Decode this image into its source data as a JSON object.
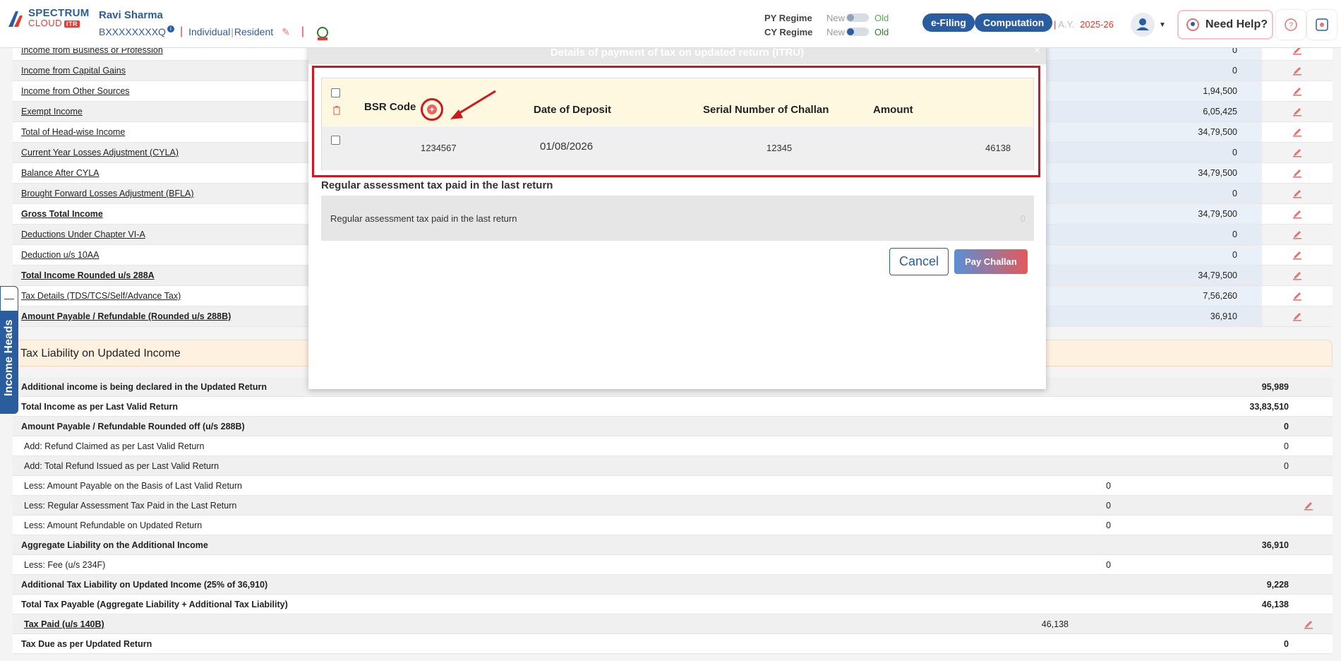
{
  "header": {
    "logo_line1": "SPECTRUM",
    "logo_line2": "CLOUD",
    "logo_badge": "ITR",
    "user_name": "Ravi Sharma",
    "pan": "BXXXXXXXXQ",
    "status_individual": "Individual",
    "status_resident": "Resident",
    "py_regime_label": "PY Regime",
    "cy_regime_label": "CY Regime",
    "toggle_new": "New",
    "toggle_old": "Old",
    "efiling": "e-Filing",
    "computation": "Computation",
    "ay_label": "A.Y.",
    "ay_value": "2025-26",
    "need_help": "Need Help?"
  },
  "income_heads": [
    {
      "label": "Income from Business or Profession",
      "value": "0"
    },
    {
      "label": "Income from Capital Gains",
      "value": "0"
    },
    {
      "label": "Income from Other Sources",
      "value": "1,94,500"
    },
    {
      "label": "Exempt Income",
      "value": "6,05,425"
    },
    {
      "label": "Total of Head-wise Income",
      "value": "34,79,500"
    },
    {
      "label": "Current Year Losses Adjustment (CYLA)",
      "value": "0"
    },
    {
      "label": "Balance After CYLA",
      "value": "34,79,500"
    },
    {
      "label": "Brought Forward Losses Adjustment (BFLA)",
      "value": "0"
    },
    {
      "label": "Gross Total Income",
      "value": "34,79,500"
    },
    {
      "label": "Deductions Under Chapter VI-A",
      "value": "0"
    },
    {
      "label": "Deduction u/s 10AA",
      "value": "0"
    },
    {
      "label": "Total Income Rounded u/s 288A",
      "value": "34,79,500"
    },
    {
      "label": "Tax Details (TDS/TCS/Self/Advance Tax)",
      "value": "7,56,260"
    },
    {
      "label": "Amount Payable / Refundable (Rounded u/s 288B)",
      "value": "36,910"
    }
  ],
  "side_tab": "Income Heads",
  "liability_section": {
    "title": "Tax Liability on Updated Income",
    "rows": [
      {
        "label": "Additional income is being declared in the Updated Return",
        "v1": "",
        "v2": "95,989"
      },
      {
        "label": "Total Income as per Last Valid Return",
        "v1": "",
        "v2": "33,83,510"
      },
      {
        "label": "Amount Payable / Refundable Rounded off (u/s 288B)",
        "v1": "",
        "v2": "0"
      },
      {
        "label": "Add: Refund Claimed as per Last Valid Return",
        "v1": "",
        "v2": "0"
      },
      {
        "label": "Add: Total Refund Issued as per Last Valid Return",
        "v1": "",
        "v2": "0"
      },
      {
        "label": "Less: Amount Payable on the Basis of Last Valid Return",
        "v1": "0",
        "v2": ""
      },
      {
        "label": "Less: Regular Assessment Tax Paid in the Last Return",
        "v1": "0",
        "v2": ""
      },
      {
        "label": "Less: Amount Refundable on Updated Return",
        "v1": "0",
        "v2": ""
      },
      {
        "label": "Aggregate Liability on the Additional Income",
        "v1": "",
        "v2": "36,910"
      },
      {
        "label": "Less: Fee (u/s 234F)",
        "v1": "0",
        "v2": ""
      },
      {
        "label": "Additional Tax Liability on Updated Income (25% of 36,910)",
        "v1": "",
        "v2": "9,228"
      },
      {
        "label": "Total Tax Payable (Aggregate Liability + Additional Tax Liability)",
        "v1": "",
        "v2": "46,138"
      },
      {
        "label": "Tax Paid (u/s 140B)",
        "v1": "46,138",
        "v2": ""
      },
      {
        "label": "Tax Due as per Updated Return",
        "v1": "",
        "v2": "0"
      }
    ]
  },
  "modal": {
    "title": "Details of payment of tax on updated return (ITRU)",
    "columns": {
      "bsr": "BSR Code",
      "date": "Date of Deposit",
      "serial": "Serial Number of Challan",
      "amount": "Amount"
    },
    "challan_row": {
      "bsr": "1234567",
      "date": "01/08/2026",
      "serial": "12345",
      "amount": "46138"
    },
    "rat_title": "Regular assessment tax paid in the last return",
    "rat_label": "Regular assessment tax paid in the last return",
    "rat_value": "0",
    "cancel": "Cancel",
    "pay": "Pay Challan"
  },
  "colors": {
    "brand_blue": "#2a5d9f",
    "accent_red": "#d0171d",
    "section_bg": "#fff1e0"
  }
}
